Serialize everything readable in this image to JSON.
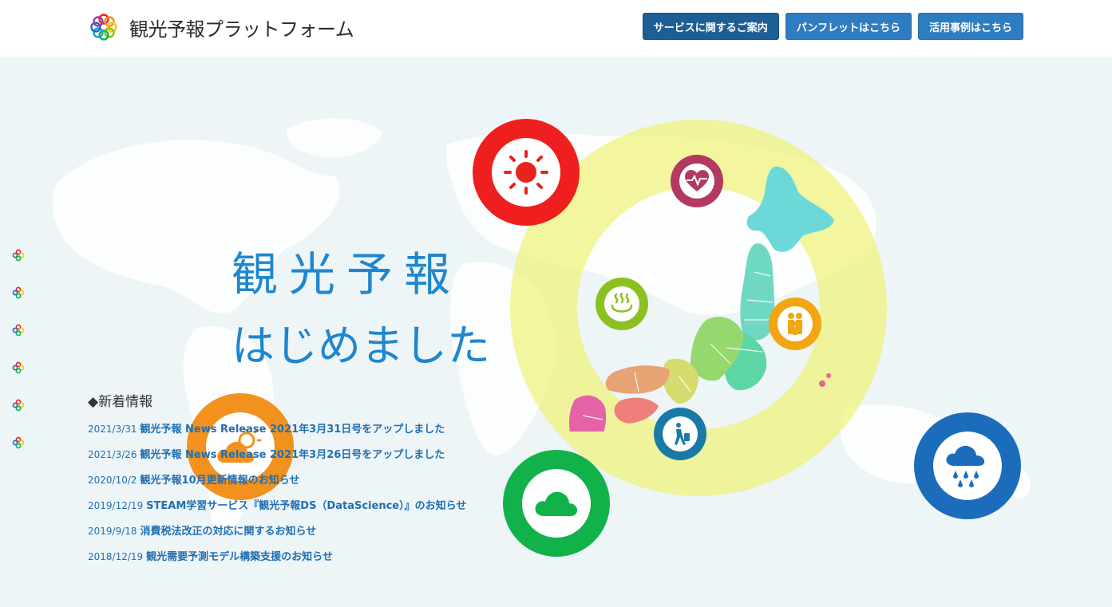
{
  "header": {
    "brand": "観光予報プラットフォーム",
    "nav": [
      {
        "label": "サービスに関するご案内",
        "active": true
      },
      {
        "label": "パンフレットはこちら",
        "active": false
      },
      {
        "label": "活用事例はこちら",
        "active": false
      }
    ]
  },
  "hero": {
    "headline_line1": "観光予報",
    "headline_line2": "はじめました",
    "icons": [
      "sun-icon",
      "heart-pulse-icon",
      "hot-spring-icon",
      "family-icon",
      "traveler-icon",
      "cloud-icon",
      "partly-cloudy-icon",
      "rain-icon"
    ],
    "colors": {
      "sun": "#e8231d",
      "heart": "#b23a5f",
      "onsen": "#8cc021",
      "family": "#f2a612",
      "traveler": "#1a7aa6",
      "cloud": "#12b24a",
      "partly_cloudy": "#f28c13",
      "rain": "#1c6cbc",
      "ring": "#eef278"
    }
  },
  "news": {
    "title": "◆新着情報",
    "items": [
      {
        "date": "2021/3/31",
        "text": "観光予報 News Release 2021年3月31日号をアップしました"
      },
      {
        "date": "2021/3/26",
        "text": "観光予報 News Release 2021年3月26日号をアップしました"
      },
      {
        "date": "2020/10/2",
        "text": "観光予報10月更新情報のお知らせ"
      },
      {
        "date": "2019/12/19",
        "text": "STEAM学習サービス『観光予報DS（DataScience）』のお知らせ"
      },
      {
        "date": "2019/9/18",
        "text": "消費税法改正の対応に関するお知らせ"
      },
      {
        "date": "2018/12/19",
        "text": "観光需要予測モデル構築支援のお知らせ"
      }
    ]
  },
  "side_nav": {
    "count": 6
  }
}
